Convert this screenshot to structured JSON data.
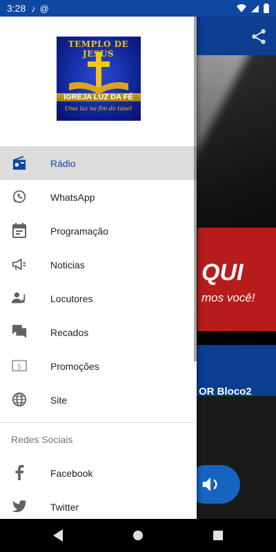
{
  "status_bar": {
    "time": "3:28",
    "battery_icon": "battery-icon",
    "wifi_icon": "wifi-icon",
    "signal_icon": "signal-icon"
  },
  "background_app": {
    "overlay_text": "QUI",
    "overlay_sub": "mos você!",
    "now_playing": "OR Bloco2"
  },
  "drawer": {
    "logo": {
      "top_text": "TEMPLO DE JESUS",
      "middle_text": "IGREJA LUZ DA FÉ",
      "bottom_text": "Uma luz no fim do túnel"
    },
    "menu": [
      {
        "label": "Rádio",
        "icon": "radio-icon",
        "active": true
      },
      {
        "label": "WhatsApp",
        "icon": "whatsapp-icon",
        "active": false
      },
      {
        "label": "Programação",
        "icon": "calendar-icon",
        "active": false
      },
      {
        "label": "Noticias",
        "icon": "megaphone-icon",
        "active": false
      },
      {
        "label": "Locutores",
        "icon": "person-voice-icon",
        "active": false
      },
      {
        "label": "Recados",
        "icon": "chat-icon",
        "active": false
      },
      {
        "label": "Promoções",
        "icon": "money-icon",
        "active": false
      },
      {
        "label": "Site",
        "icon": "globe-icon",
        "active": false
      }
    ],
    "social_section_title": "Redes Sociais",
    "social": [
      {
        "label": "Facebook",
        "icon": "facebook-icon"
      },
      {
        "label": "Twitter",
        "icon": "twitter-icon"
      }
    ]
  },
  "colors": {
    "primary": "#0d47a1",
    "active_bg": "#dcdcdc",
    "icon_gray": "#616161"
  }
}
